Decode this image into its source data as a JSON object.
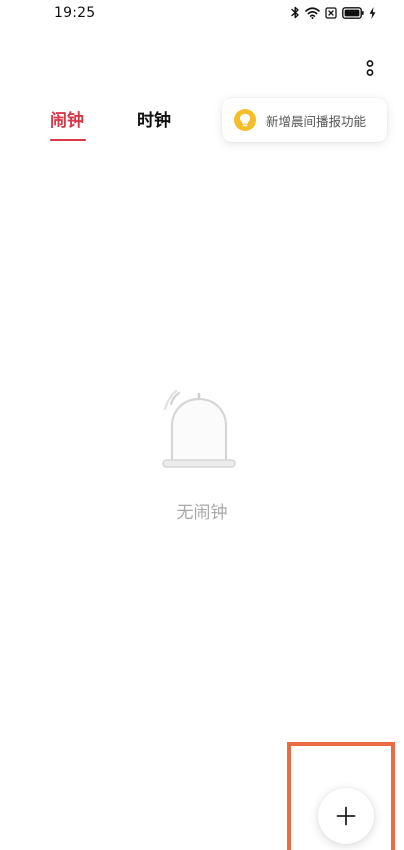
{
  "status_bar": {
    "time": "19:25",
    "icons": [
      "bluetooth-icon",
      "wifi-icon",
      "sim-card-icon",
      "battery-icon",
      "charging-icon"
    ]
  },
  "header": {
    "more_icon": "more-vertical-icon"
  },
  "tabs": [
    {
      "label": "闹钟",
      "active": true
    },
    {
      "label": "时钟",
      "active": false
    }
  ],
  "tooltip": {
    "text": "新增晨间播报功能",
    "icon": "lightbulb-icon"
  },
  "empty_state": {
    "icon": "bell-icon",
    "text": "无闹钟"
  },
  "fab": {
    "icon": "plus-icon"
  },
  "colors": {
    "accent": "#d8384a",
    "tooltip_icon_bg": "#f5bd28",
    "empty_text": "#a8a8a8",
    "highlight_border": "#ea6a45"
  }
}
